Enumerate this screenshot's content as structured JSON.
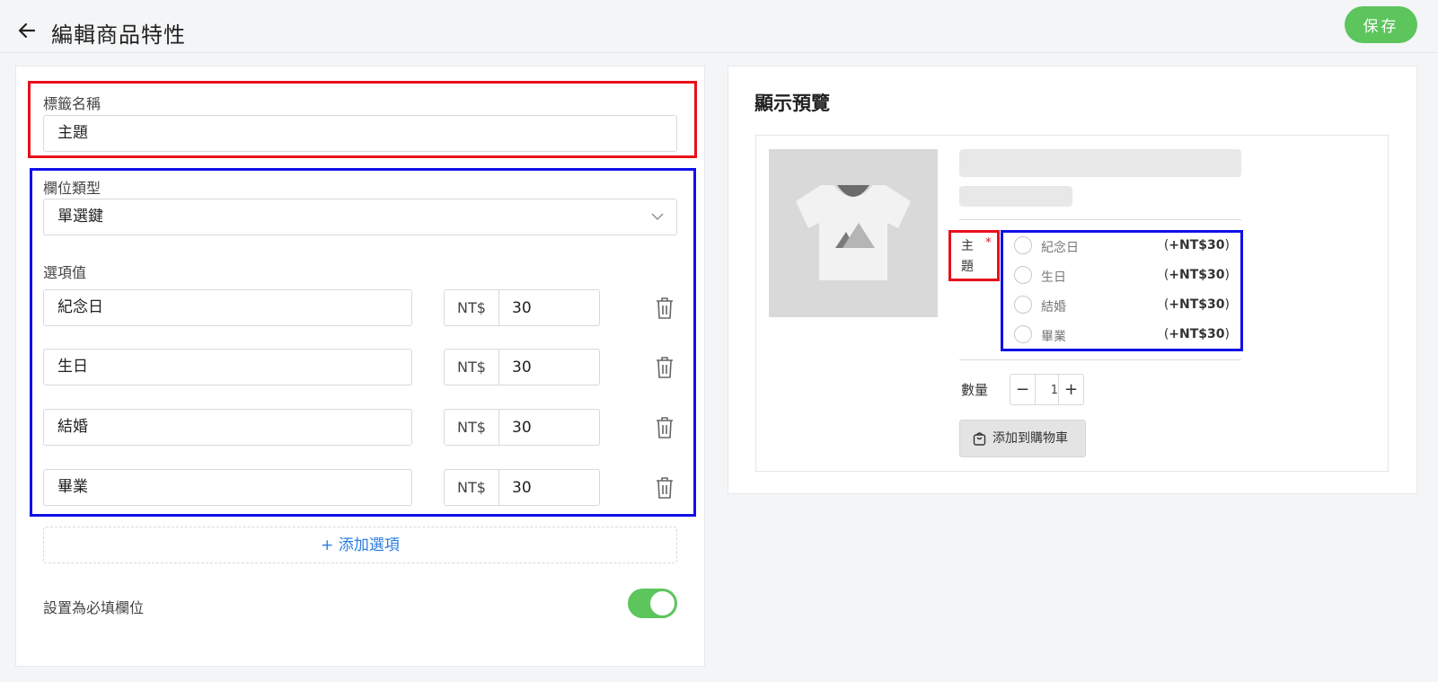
{
  "header": {
    "title": "編輯商品特性",
    "save_label": "保存"
  },
  "form": {
    "tag_name_label": "標籤名稱",
    "tag_name_value": "主題",
    "field_type_label": "欄位類型",
    "field_type_value": "單選鍵",
    "options_label": "選項值",
    "options": [
      {
        "name": "紀念日",
        "currency": "NT$",
        "price": "30"
      },
      {
        "name": "生日",
        "currency": "NT$",
        "price": "30"
      },
      {
        "name": "結婚",
        "currency": "NT$",
        "price": "30"
      },
      {
        "name": "畢業",
        "currency": "NT$",
        "price": "30"
      }
    ],
    "add_option_label": "+ 添加選項",
    "required_label": "設置為必填欄位",
    "required_on": true
  },
  "preview": {
    "title": "顯示預覽",
    "field_label": "主題",
    "required_mark": "*",
    "options": [
      {
        "name": "紀念日",
        "price_open": "(",
        "price": "+NT$30",
        "price_close": ")"
      },
      {
        "name": "生日",
        "price_open": "(",
        "price": "+NT$30",
        "price_close": ")"
      },
      {
        "name": "結婚",
        "price_open": "(",
        "price": "+NT$30",
        "price_close": ")"
      },
      {
        "name": "畢業",
        "price_open": "(",
        "price": "+NT$30",
        "price_close": ")"
      }
    ],
    "quantity_label": "數量",
    "quantity_minus": "−",
    "quantity_value": "1",
    "quantity_plus": "+",
    "add_to_cart_label": "添加到購物車"
  },
  "colors": {
    "accent_green": "#5cc55c",
    "highlight_red": "#e8101c",
    "highlight_blue": "#1010e8",
    "link_blue": "#2a7de1"
  }
}
